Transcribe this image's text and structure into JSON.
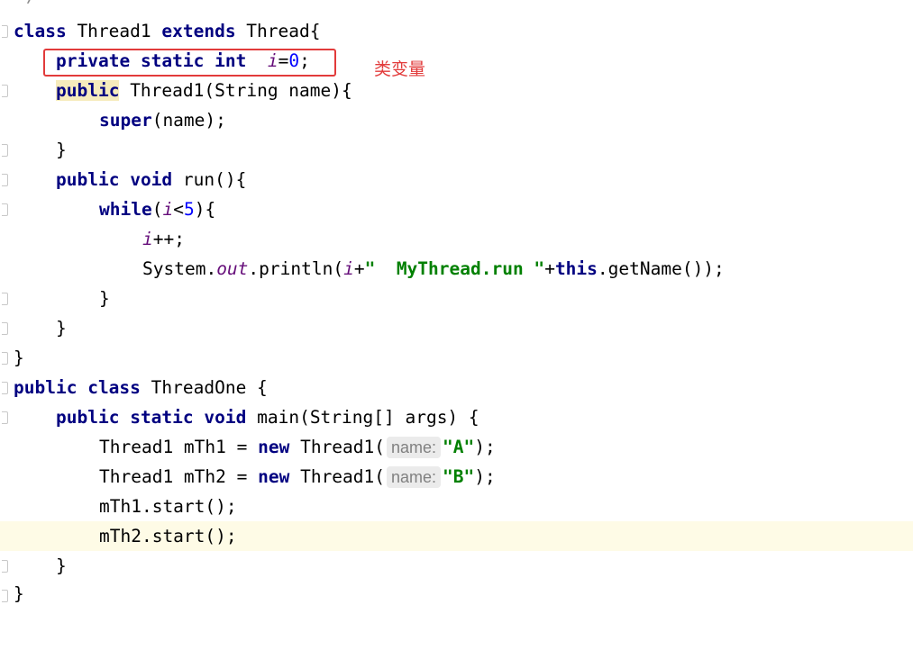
{
  "editor": {
    "comment_fragment": "*/",
    "lines": {
      "l1": {
        "kw1": "class",
        "t1": " Thread1 ",
        "kw2": "extends",
        "t2": " Thread{"
      },
      "l2": {
        "kw1": "private",
        "kw2": "static",
        "kw3": "int",
        "field": "i",
        "op": "=",
        "num": "0",
        "end": ";"
      },
      "l3": {
        "kw1": "public",
        "t1": " Thread1(String name){"
      },
      "l4": {
        "kw1": "super",
        "t1": "(name);"
      },
      "l5": {
        "t1": "}"
      },
      "l6": {
        "kw1": "public",
        "kw2": "void",
        "t1": " run(){"
      },
      "l7": {
        "kw1": "while",
        "t1": "(",
        "field": "i",
        "t2": "<",
        "num": "5",
        "t3": "){"
      },
      "l8": {
        "field": "i",
        "t1": "++;"
      },
      "l9": {
        "t1": "System.",
        "sfield": "out",
        "t2": ".println(",
        "field": "i",
        "t3": "+",
        "str": "\"  MyThread.run \"",
        "t4": "+",
        "kw1": "this",
        "t5": ".getName());"
      },
      "l10": {
        "t1": "}"
      },
      "l11": {
        "t1": "}"
      },
      "l12": {
        "t1": "}"
      },
      "l13": {
        "kw1": "public",
        "kw2": "class",
        "t1": " ThreadOne {"
      },
      "l14": {
        "kw1": "public",
        "kw2": "static",
        "kw3": "void",
        "t1": " main(String[] args) {"
      },
      "l15": {
        "t1": "Thread1 mTh1 = ",
        "kw1": "new",
        "t2": " Thread1(",
        "hint": "name:",
        "str": "\"A\"",
        "t3": ");"
      },
      "l16": {
        "t1": "Thread1 mTh2 = ",
        "kw1": "new",
        "t2": " Thread1(",
        "hint": "name:",
        "str": "\"B\"",
        "t3": ");"
      },
      "l17": {
        "t1": "mTh1.start();"
      },
      "l18": {
        "t1": "mTh2.start();"
      },
      "l19": {
        "t1": "}"
      },
      "l20": {
        "t1": "}"
      }
    }
  },
  "annotation": {
    "label": "类变量",
    "color": "#e23b3b"
  }
}
